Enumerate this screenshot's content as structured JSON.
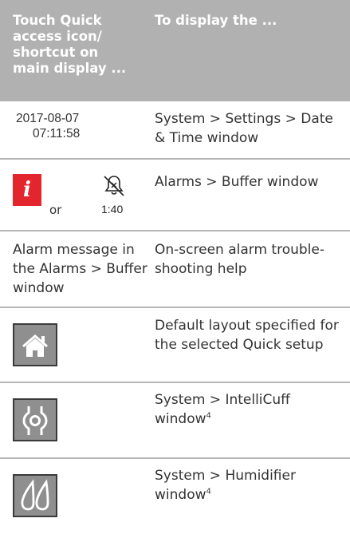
{
  "header": {
    "col1": "Touch Quick access icon/ shortcut on main display ...",
    "col2": "To display the ..."
  },
  "rows": [
    {
      "left_line1": "2017-08-07",
      "left_line2": "07:11:58",
      "right": "System > Settings > Date & Time window"
    },
    {
      "left_or": "or",
      "timer": "1:40",
      "right": "Alarms > Buffer window",
      "icons": [
        "info-icon",
        "alarm-silence-bell-icon"
      ],
      "info_icon_color": "#e3262e",
      "info_glyph": "i"
    },
    {
      "left": "Alarm message in the Alarms > Buffer window",
      "right": "On-screen alarm trouble-shooting help"
    },
    {
      "icon": "home-icon",
      "right": "Default layout specified for the selected Quick setup"
    },
    {
      "icon": "intellicuff-icon",
      "right_main": "System > IntelliCuff window",
      "right_sup": "4"
    },
    {
      "icon": "humidifier-icon",
      "right_main": "System > Humidifier window",
      "right_sup": "4"
    }
  ],
  "colors": {
    "header_bg": "#b1b1b1",
    "separator": "#b6b6b6",
    "button_bg": "#8f8f8f"
  }
}
